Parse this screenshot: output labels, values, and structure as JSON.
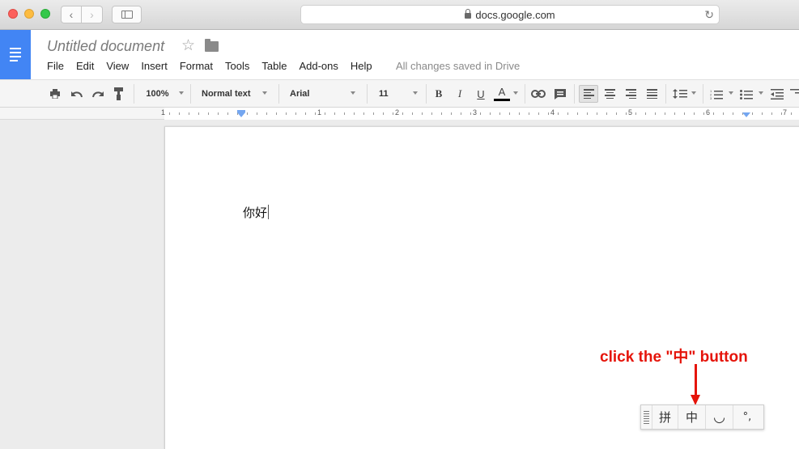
{
  "browser": {
    "url": "docs.google.com"
  },
  "document": {
    "title": "Untitled document",
    "body_text": "你好",
    "save_status": "All changes saved in Drive"
  },
  "menu": {
    "items": [
      "File",
      "Edit",
      "View",
      "Insert",
      "Format",
      "Tools",
      "Table",
      "Add-ons",
      "Help"
    ]
  },
  "toolbar": {
    "zoom": "100%",
    "style": "Normal text",
    "font": "Arial",
    "size": "11",
    "bold": "B",
    "italic": "I",
    "underline": "U",
    "text_color": "A"
  },
  "ruler": {
    "numbers": [
      "1",
      "1",
      "2",
      "3",
      "4",
      "5",
      "6",
      "7"
    ]
  },
  "ime_toolbar": {
    "pinyin": "拼",
    "chinese": "中",
    "half_full": "◡",
    "punctuation": "°,"
  },
  "annotation": {
    "text": "click the \"中\" button"
  },
  "colors": {
    "docs_blue": "#4285f4",
    "annotation_red": "#e5140a"
  }
}
